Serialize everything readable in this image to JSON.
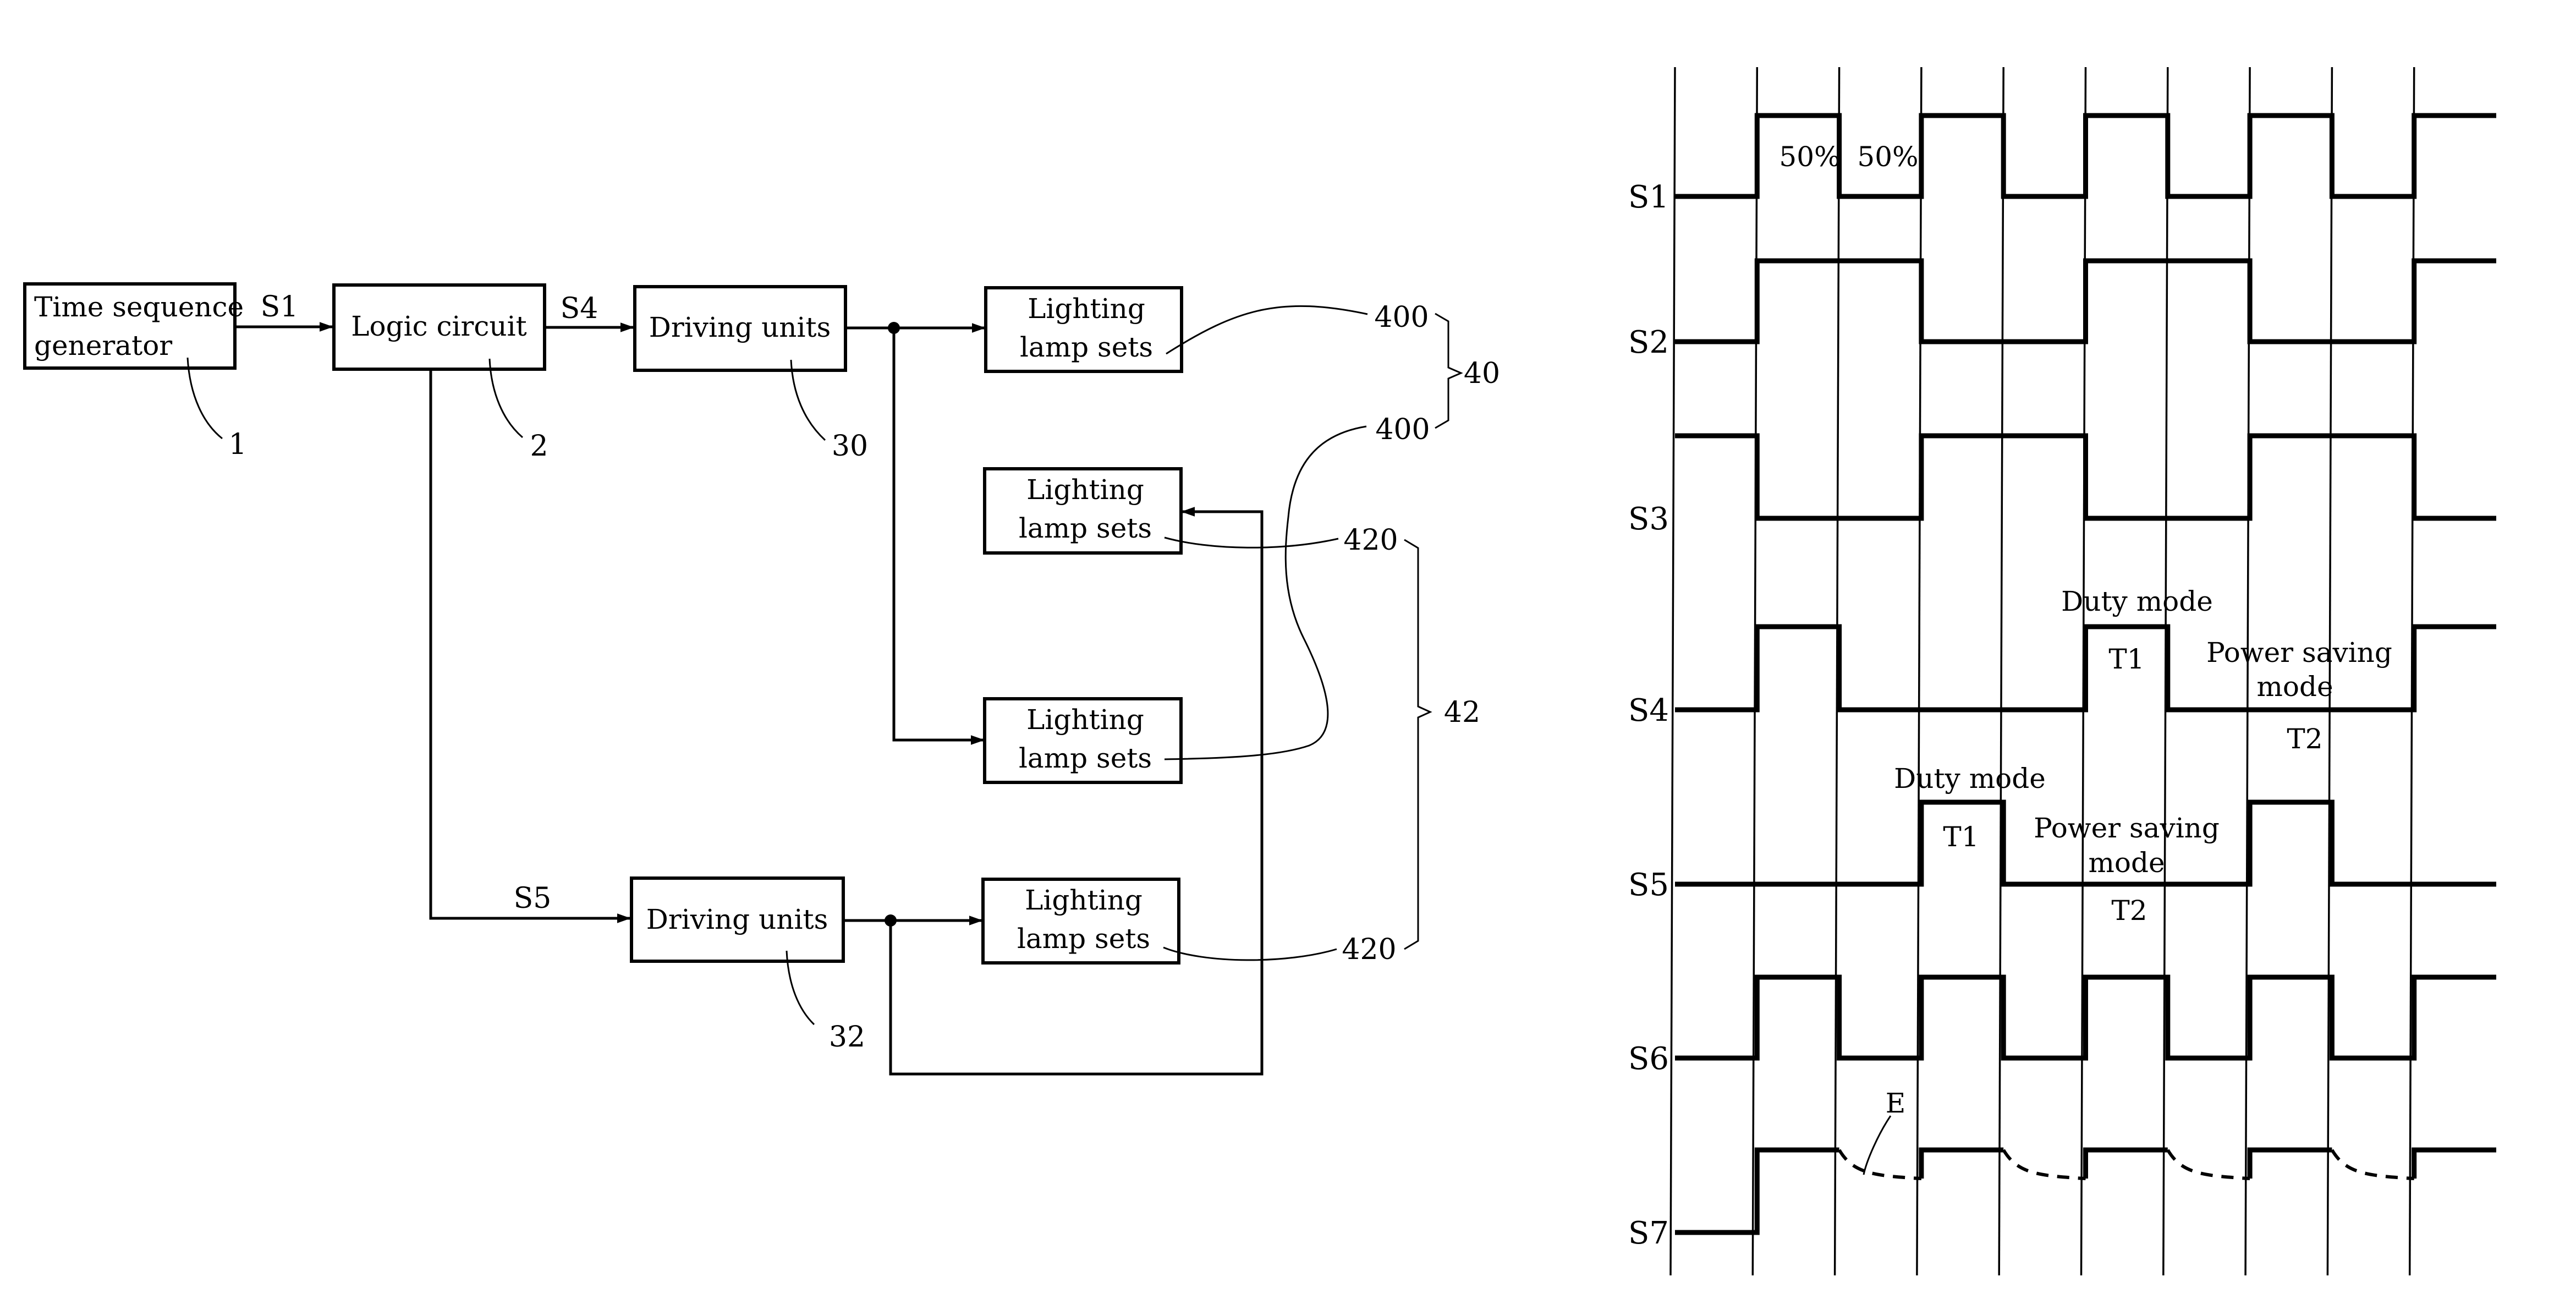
{
  "block_diagram": {
    "blocks": {
      "time_sequence_generator": [
        "Time sequence",
        "generator"
      ],
      "logic_circuit": [
        "Logic circuit"
      ],
      "driving_units_30": [
        "Driving units"
      ],
      "driving_units_32": [
        "Driving units"
      ],
      "lamp_set": [
        "Lighting",
        "lamp sets"
      ]
    },
    "signals": {
      "s1": "S1",
      "s4": "S4",
      "s5": "S5"
    },
    "reference_numerals": {
      "tsg": "1",
      "logic": "2",
      "driver_a": "30",
      "driver_b": "32",
      "lamp_a_top": "400",
      "lamp_a_bottom": "400",
      "group_a": "40",
      "lamp_b_top": "420",
      "lamp_b_bottom": "420",
      "group_b": "42"
    }
  },
  "timing_diagram": {
    "slots": 10,
    "signals": [
      {
        "name": "S1",
        "levels": [
          0,
          1,
          0,
          1,
          0,
          1,
          0,
          1,
          0,
          1
        ]
      },
      {
        "name": "S2",
        "levels": [
          0,
          1,
          1,
          0,
          0,
          1,
          1,
          0,
          0,
          1
        ]
      },
      {
        "name": "S3",
        "levels": [
          1,
          0,
          0,
          1,
          1,
          0,
          0,
          1,
          1,
          0
        ]
      },
      {
        "name": "S4",
        "levels": [
          0,
          1,
          0,
          0,
          0,
          1,
          0,
          0,
          0,
          1
        ]
      },
      {
        "name": "S5",
        "levels": [
          0,
          0,
          0,
          1,
          0,
          0,
          0,
          1,
          0,
          0
        ]
      },
      {
        "name": "S6",
        "levels": [
          0,
          1,
          0,
          1,
          0,
          1,
          0,
          1,
          0,
          1
        ]
      },
      {
        "name": "S7",
        "levels": [
          0,
          1,
          "decay",
          1,
          "decay",
          1,
          "decay",
          1,
          "decay",
          1
        ]
      }
    ],
    "annotations": {
      "duty_cycle_high": "50%",
      "duty_cycle_low": "50%",
      "s4_duty_mode": "Duty mode",
      "s4_t1": "T1",
      "s4_power_saving_line1": "Power saving",
      "s4_power_saving_line2": "mode",
      "s4_t2": "T2",
      "s5_duty_mode": "Duty mode",
      "s5_t1": "T1",
      "s5_power_saving_line1": "Power saving",
      "s5_power_saving_line2": "mode",
      "s5_t2": "T2",
      "decay_label": "E"
    }
  }
}
